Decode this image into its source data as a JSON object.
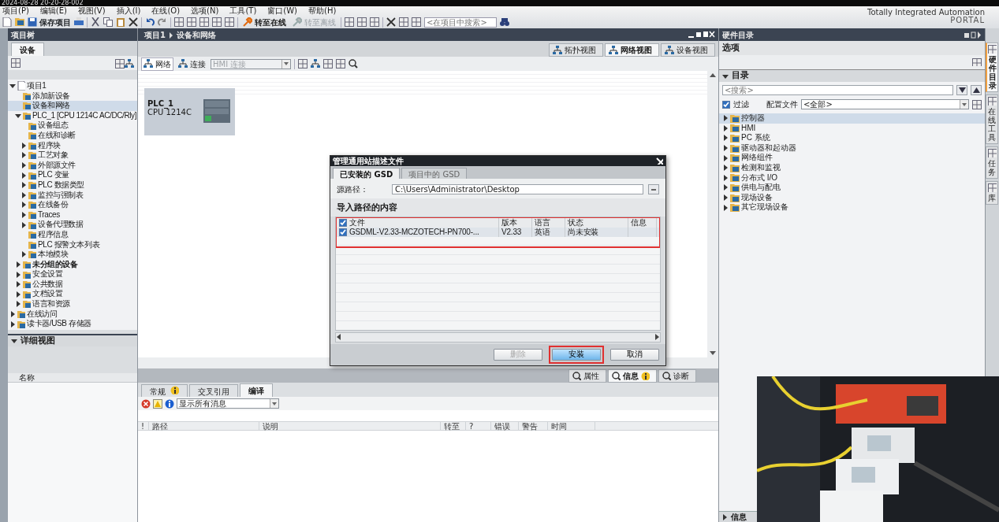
{
  "header": {
    "timestamp": "2024-08-28 20-20-28-002",
    "brand": "Totally Integrated Automation",
    "brand_sub": "PORTAL"
  },
  "menu": [
    "项目(P)",
    "编辑(E)",
    "视图(V)",
    "插入(I)",
    "在线(O)",
    "选项(N)",
    "工具(T)",
    "窗口(W)",
    "帮助(H)"
  ],
  "toolbar": {
    "save": "保存项目",
    "go_online": {
      "label": "转至在线",
      "disabled": false
    },
    "go_offline": {
      "label": "转至离线",
      "disabled": true
    },
    "search": {
      "placeholder": "<在项目中搜索>"
    }
  },
  "project_tree": {
    "title": "项目树",
    "tabs": [
      {
        "label": "设备",
        "selected": true
      }
    ],
    "items": [
      {
        "label": "项目1",
        "expanded": true,
        "selected": false,
        "children": [
          {
            "label": "添加新设备",
            "selected": false
          },
          {
            "label": "设备和网络",
            "selected": true
          },
          {
            "label": "PLC_1 [CPU 1214C AC/DC/Rly]",
            "expanded": true,
            "selected": false,
            "children": [
              {
                "label": "设备组态",
                "selected": false
              },
              {
                "label": "在线和诊断",
                "selected": false
              },
              {
                "label": "程序块",
                "expanded": false,
                "selected": false
              },
              {
                "label": "工艺对象",
                "expanded": false,
                "selected": false
              },
              {
                "label": "外部源文件",
                "expanded": false,
                "selected": false
              },
              {
                "label": "PLC 变量",
                "expanded": false,
                "selected": false
              },
              {
                "label": "PLC 数据类型",
                "expanded": false,
                "selected": false
              },
              {
                "label": "监控与强制表",
                "expanded": false,
                "selected": false
              },
              {
                "label": "在线备份",
                "expanded": false,
                "selected": false
              },
              {
                "label": "Traces",
                "expanded": false,
                "selected": false
              },
              {
                "label": "设备代理数据",
                "expanded": false,
                "selected": false
              },
              {
                "label": "程序信息",
                "selected": false
              },
              {
                "label": "PLC 报警文本列表",
                "selected": false
              },
              {
                "label": "本地模块",
                "expanded": false,
                "selected": false
              }
            ]
          },
          {
            "label": "未分组的设备",
            "expanded": false,
            "selected": false,
            "bold": true
          },
          {
            "label": "安全设置",
            "expanded": false,
            "selected": false
          },
          {
            "label": "公共数据",
            "expanded": false,
            "selected": false
          },
          {
            "label": "文档设置",
            "expanded": false,
            "selected": false
          },
          {
            "label": "语言和资源",
            "expanded": false,
            "selected": false
          }
        ]
      },
      {
        "label": "在线访问",
        "expanded": false,
        "selected": false
      },
      {
        "label": "读卡器/USB 存储器",
        "expanded": false,
        "selected": false
      }
    ]
  },
  "detail_view": {
    "title": "详细视图",
    "expanded": true,
    "columns": [
      "名称"
    ]
  },
  "editor": {
    "breadcrumb": [
      "项目1",
      "设备和网络"
    ],
    "view_tabs": [
      {
        "label": "拓扑视图",
        "selected": false
      },
      {
        "label": "网络视图",
        "selected": true
      },
      {
        "label": "设备视图",
        "selected": false
      }
    ],
    "toolbar": {
      "network": "网络",
      "connections": "连接",
      "connection_type": {
        "value": "HMI 连接",
        "disabled": true
      }
    },
    "devices": [
      {
        "name": "PLC_1",
        "type": "CPU 1214C"
      }
    ]
  },
  "dialog": {
    "title": "管理通用站描述文件",
    "tabs": [
      {
        "label": "已安装的 GSD",
        "selected": true
      },
      {
        "label": "项目中的 GSD",
        "selected": false
      }
    ],
    "source_path": {
      "label": "源路径：",
      "value": "C:\\Users\\Administrator\\Desktop"
    },
    "section": "导入路径的内容",
    "table": {
      "highlighted": true,
      "all_checked": true,
      "columns": [
        "文件",
        "版本",
        "语言",
        "状态",
        "信息"
      ],
      "rows": [
        {
          "checked": true,
          "cells": [
            "GSDML-V2.33-MCZOTECH-PN700-...",
            "V2.33",
            "英语",
            "尚未安装",
            ""
          ]
        }
      ]
    },
    "buttons": [
      {
        "label": "删除",
        "disabled": true,
        "highlighted": false
      },
      {
        "label": "安装",
        "disabled": false,
        "highlighted": true
      },
      {
        "label": "取消",
        "disabled": false,
        "highlighted": false
      }
    ]
  },
  "inspector": {
    "tabs": [
      {
        "label": "属性",
        "selected": false,
        "info": false
      },
      {
        "label": "信息",
        "selected": true,
        "info": true
      },
      {
        "label": "诊断",
        "selected": false,
        "info": false
      }
    ],
    "sub_tabs": [
      {
        "label": "常规",
        "selected": false,
        "info": true
      },
      {
        "label": "交叉引用",
        "selected": false,
        "info": false
      },
      {
        "label": "编译",
        "selected": true,
        "info": false
      }
    ],
    "filter": "显示所有消息",
    "columns": [
      "!",
      "路径",
      "说明",
      "转至",
      "?",
      "错误",
      "警告",
      "时间"
    ]
  },
  "catalog": {
    "title": "硬件目录",
    "options": "选项",
    "section": {
      "title": "目录",
      "expanded": true
    },
    "search": {
      "placeholder": "<搜索>"
    },
    "filter": {
      "label": "过滤",
      "checked": true
    },
    "profile": {
      "label": "配置文件",
      "value": "<全部>"
    },
    "items": [
      {
        "label": "控制器",
        "expanded": false,
        "selected": true
      },
      {
        "label": "HMI",
        "expanded": false,
        "selected": false
      },
      {
        "label": "PC 系统",
        "expanded": false,
        "selected": false
      },
      {
        "label": "驱动器和起动器",
        "expanded": false,
        "selected": false
      },
      {
        "label": "网络组件",
        "expanded": false,
        "selected": false
      },
      {
        "label": "检测和监视",
        "expanded": false,
        "selected": false
      },
      {
        "label": "分布式 I/O",
        "expanded": false,
        "selected": false
      },
      {
        "label": "供电与配电",
        "expanded": false,
        "selected": false
      },
      {
        "label": "现场设备",
        "expanded": false,
        "selected": false
      },
      {
        "label": "其它现场设备",
        "expanded": false,
        "selected": false
      }
    ]
  },
  "side_tabs": [
    {
      "label": "硬件目录",
      "selected": true
    },
    {
      "label": "在线工具",
      "selected": false
    },
    {
      "label": "任务",
      "selected": false
    },
    {
      "label": "库",
      "selected": false
    }
  ],
  "info_panel": {
    "title": "信息",
    "expanded": false
  },
  "video": {
    "kind": "picture"
  }
}
